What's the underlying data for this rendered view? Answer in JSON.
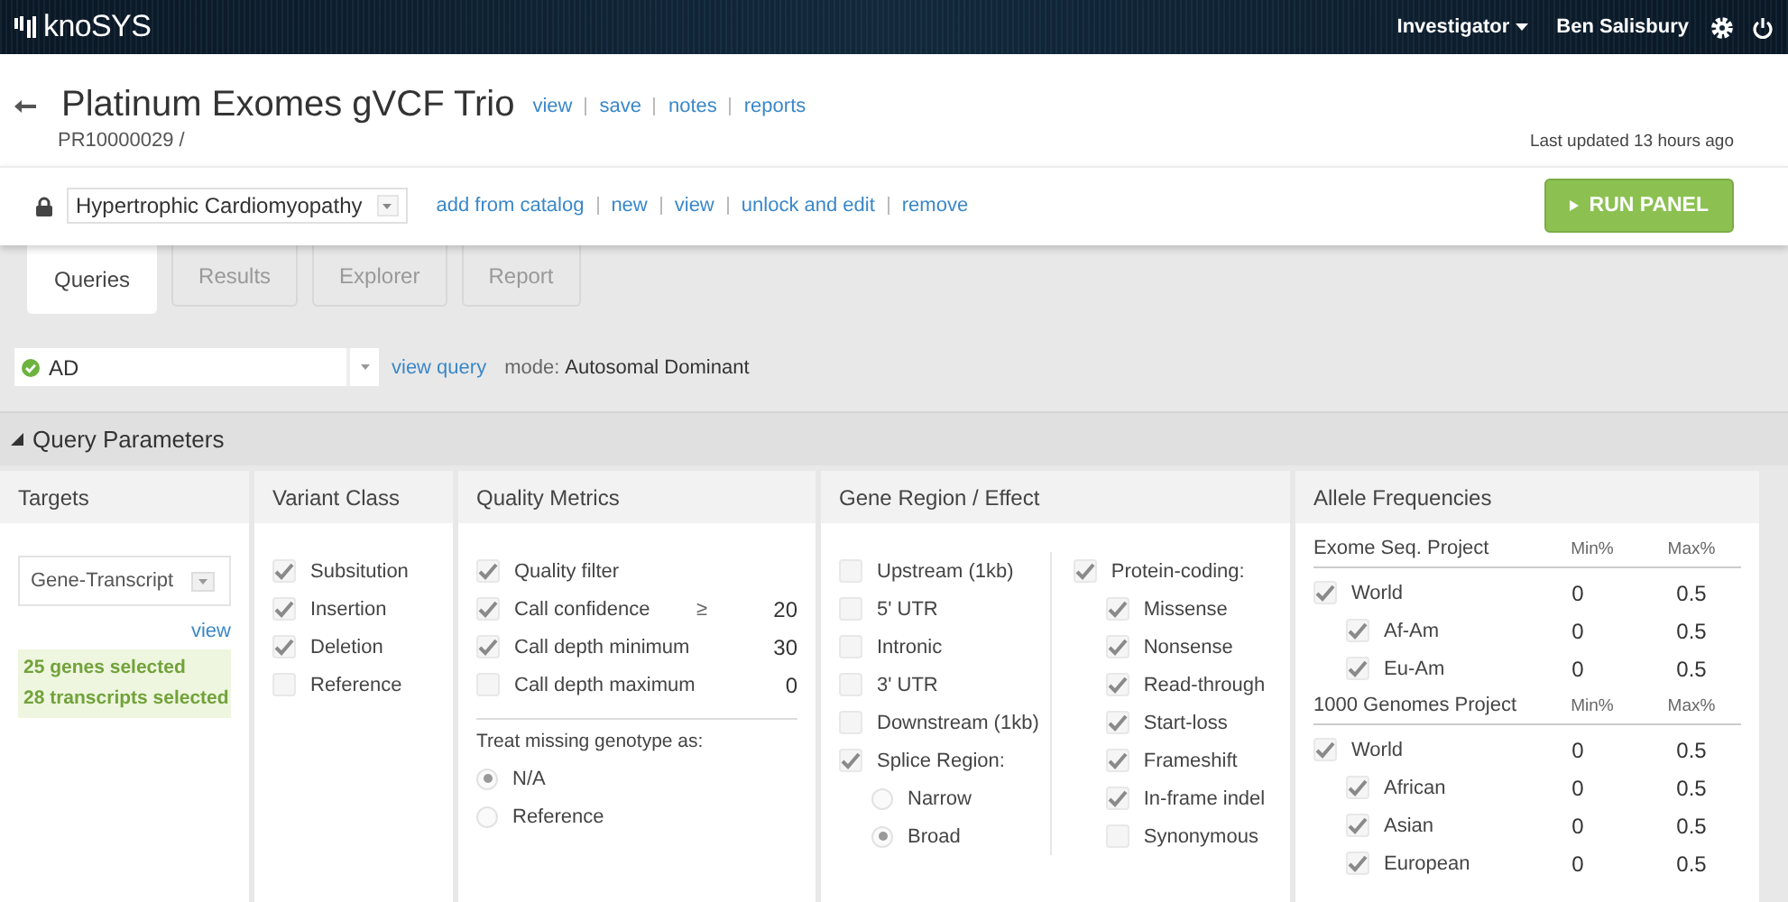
{
  "topbar": {
    "logo": "knoSYS",
    "role": "Investigator",
    "user": "Ben Salisbury"
  },
  "project": {
    "title": "Platinum Exomes gVCF Trio",
    "links": [
      "view",
      "save",
      "notes",
      "reports"
    ],
    "id": "PR10000029 /",
    "updated": "Last updated 13 hours ago"
  },
  "panel": {
    "locked": true,
    "name": "Hypertrophic Cardiomyopathy",
    "links": [
      "add from catalog",
      "new",
      "view",
      "unlock and edit",
      "remove"
    ],
    "run_button": "RUN PANEL"
  },
  "tabs": [
    {
      "label": "Queries",
      "selected": true
    },
    {
      "label": "Results",
      "selected": false
    },
    {
      "label": "Explorer",
      "selected": false
    },
    {
      "label": "Report",
      "selected": false
    }
  ],
  "query": {
    "name": "AD",
    "valid": true,
    "link": "view query",
    "mode_label": "mode:",
    "mode": "Autosomal Dominant"
  },
  "parameters": {
    "title": "Query Parameters",
    "expanded": true,
    "targets": {
      "title": "Targets",
      "select": "Gene-Transcript",
      "link": "view",
      "summary": [
        "25 genes selected",
        "28 transcripts selected"
      ]
    },
    "variant_class": {
      "title": "Variant Class",
      "items": [
        {
          "label": "Subsitution",
          "checked": true
        },
        {
          "label": "Insertion",
          "checked": true
        },
        {
          "label": "Deletion",
          "checked": true
        },
        {
          "label": "Reference",
          "checked": false
        }
      ]
    },
    "quality": {
      "title": "Quality Metrics",
      "items": [
        {
          "label": "Quality filter",
          "checked": true
        },
        {
          "label": "Call confidence",
          "checked": true,
          "operator": "≥",
          "value": "20"
        },
        {
          "label": "Call depth minimum",
          "checked": true,
          "value": "30"
        },
        {
          "label": "Call depth maximum",
          "checked": false,
          "value": "0"
        }
      ],
      "missing_label": "Treat missing genotype as:",
      "missing_options": [
        {
          "label": "N/A",
          "selected": true
        },
        {
          "label": "Reference",
          "selected": false
        }
      ]
    },
    "gene_region": {
      "title": "Gene Region / Effect",
      "regions": [
        {
          "label": "Upstream (1kb)",
          "checked": false
        },
        {
          "label": "5' UTR",
          "checked": false
        },
        {
          "label": "Intronic",
          "checked": false
        },
        {
          "label": "3' UTR",
          "checked": false
        },
        {
          "label": "Downstream (1kb)",
          "checked": false
        },
        {
          "label": "Splice Region:",
          "checked": true,
          "options": [
            {
              "label": "Narrow",
              "selected": false
            },
            {
              "label": "Broad",
              "selected": true
            }
          ]
        }
      ],
      "coding": {
        "label": "Protein-coding:",
        "checked": true,
        "children": [
          {
            "label": "Missense",
            "checked": true
          },
          {
            "label": "Nonsense",
            "checked": true
          },
          {
            "label": "Read-through",
            "checked": true
          },
          {
            "label": "Start-loss",
            "checked": true
          },
          {
            "label": "Frameshift",
            "checked": true
          },
          {
            "label": "In-frame indel",
            "checked": true
          },
          {
            "label": "Synonymous",
            "checked": false
          }
        ]
      }
    },
    "allele": {
      "title": "Allele Frequencies",
      "groups": [
        {
          "name": "Exome Seq. Project",
          "min_label": "Min%",
          "max_label": "Max%",
          "populations": [
            {
              "label": "World",
              "checked": true,
              "min": "0",
              "max": "0.5",
              "children": [
                {
                  "label": "Af-Am",
                  "checked": true,
                  "min": "0",
                  "max": "0.5"
                },
                {
                  "label": "Eu-Am",
                  "checked": true,
                  "min": "0",
                  "max": "0.5"
                }
              ]
            }
          ]
        },
        {
          "name": "1000 Genomes Project",
          "min_label": "Min%",
          "max_label": "Max%",
          "populations": [
            {
              "label": "World",
              "checked": true,
              "min": "0",
              "max": "0.5",
              "children": [
                {
                  "label": "African",
                  "checked": true,
                  "min": "0",
                  "max": "0.5"
                },
                {
                  "label": "Asian",
                  "checked": true,
                  "min": "0",
                  "max": "0.5"
                },
                {
                  "label": "European",
                  "checked": true,
                  "min": "0",
                  "max": "0.5"
                }
              ]
            }
          ]
        }
      ]
    }
  }
}
